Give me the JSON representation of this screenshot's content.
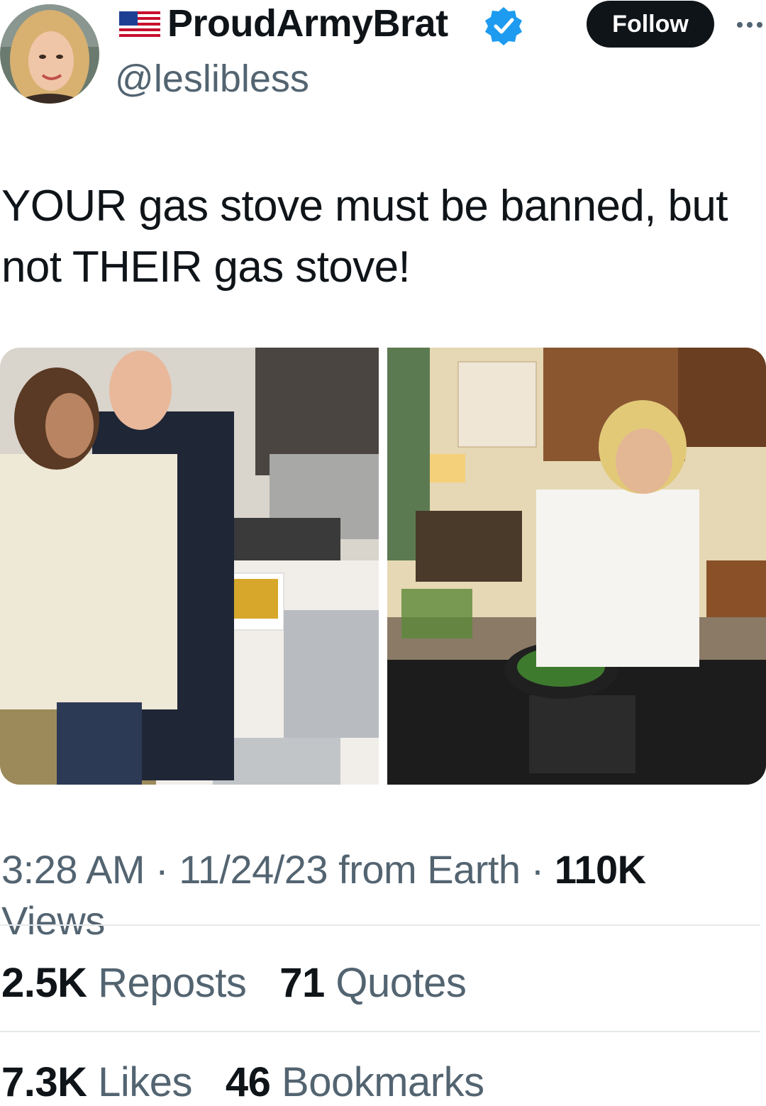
{
  "user": {
    "display_name": "ProudArmyBrat",
    "handle": "@leslibless",
    "flag_icon": "us-flag-icon",
    "verified_icon": "verified-badge-icon",
    "verified_color": "#1d9bf0"
  },
  "actions": {
    "follow_label": "Follow",
    "more_icon": "more-options-icon"
  },
  "tweet": {
    "text": "YOUR gas stove must be banned, but not THEIR gas stove!"
  },
  "media": [
    {
      "name": "photo-kitchen-couple"
    },
    {
      "name": "photo-woman-cooking"
    }
  ],
  "meta": {
    "time": "3:28 AM",
    "date": "11/24/23",
    "source": "from Earth",
    "sep": "·",
    "views_count": "110K",
    "views_label": "Views"
  },
  "stats": {
    "reposts_count": "2.5K",
    "reposts_label": "Reposts",
    "quotes_count": "71",
    "quotes_label": "Quotes",
    "likes_count": "7.3K",
    "likes_label": "Likes",
    "bookmarks_count": "46",
    "bookmarks_label": "Bookmarks"
  },
  "colors": {
    "text_primary": "#0f1419",
    "text_secondary": "#536471",
    "follow_bg": "#0f1419",
    "divider": "#e7e9ea"
  }
}
